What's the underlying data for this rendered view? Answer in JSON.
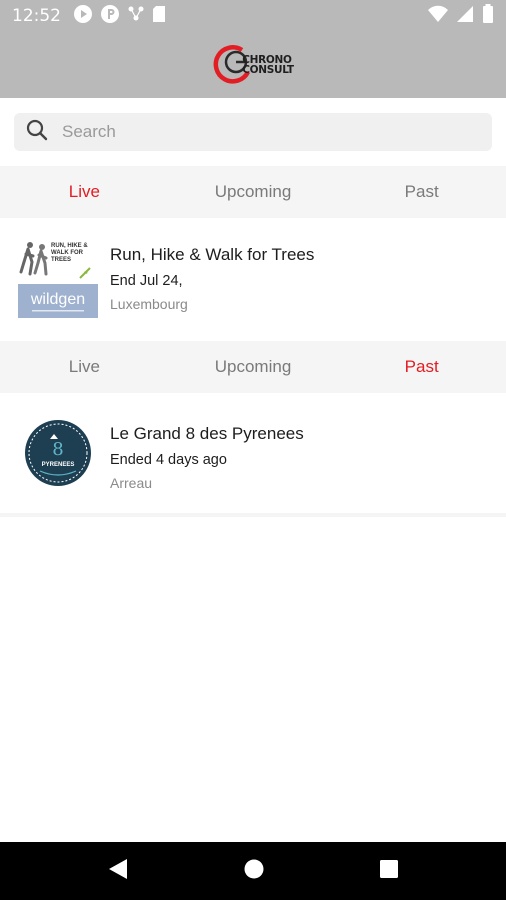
{
  "status": {
    "time": "12:52"
  },
  "app": {
    "brand_line1": "CHRONO",
    "brand_line2": "CONSULT",
    "brand_red": "#e21d23"
  },
  "search": {
    "placeholder": "Search",
    "value": ""
  },
  "tabs_live": {
    "live": "Live",
    "upcoming": "Upcoming",
    "past": "Past",
    "active": "Live"
  },
  "tabs_past": {
    "live": "Live",
    "upcoming": "Upcoming",
    "past": "Past",
    "active": "Past"
  },
  "events_live": [
    {
      "title": "Run, Hike & Walk for Trees",
      "date_prefix": "End",
      "date_value": "Jul 24,",
      "location": "Luxembourg",
      "thumb_lines": [
        "RUN, HIKE & WALK FOR TREES"
      ],
      "thumb_brand": "wildgen"
    }
  ],
  "events_past": [
    {
      "title": "Le Grand 8 des Pyrenees",
      "date_prefix": "Ended",
      "date_value": "4 days ago",
      "location": "Arreau",
      "thumb_text": "PYRENEES"
    }
  ]
}
